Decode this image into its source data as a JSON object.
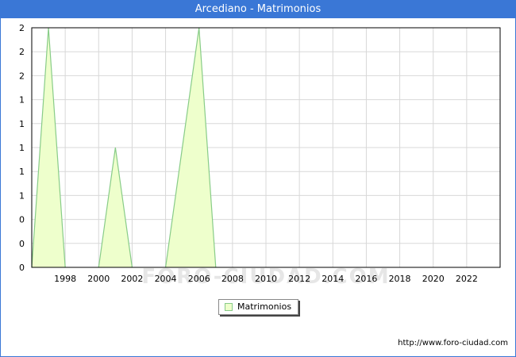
{
  "header": {
    "title": "Arcediano - Matrimonios"
  },
  "chart_data": {
    "type": "area",
    "title": "Arcediano - Matrimonios",
    "xlabel": "",
    "ylabel": "",
    "x": [
      1996,
      1997,
      1998,
      1999,
      2000,
      2001,
      2002,
      2003,
      2004,
      2005,
      2006,
      2007,
      2008,
      2009,
      2010,
      2011,
      2012,
      2013,
      2014,
      2015,
      2016,
      2017,
      2018,
      2019,
      2020,
      2021,
      2022
    ],
    "series": [
      {
        "name": "Matrimonios",
        "values": [
          0,
          2,
          0,
          0,
          0,
          1,
          0,
          0,
          0,
          1,
          2,
          0,
          0,
          0,
          0,
          0,
          0,
          0,
          0,
          0,
          0,
          0,
          0,
          0,
          0,
          0,
          0
        ]
      }
    ],
    "xlim": [
      1996,
      2024
    ],
    "ylim": [
      0,
      2
    ],
    "x_ticks": [
      1998,
      2000,
      2002,
      2004,
      2006,
      2008,
      2010,
      2012,
      2014,
      2016,
      2018,
      2020,
      2022
    ],
    "y_tick_labels": [
      "0",
      "0",
      "0",
      "1",
      "1",
      "1",
      "1",
      "1",
      "2",
      "2",
      "2"
    ],
    "grid": true,
    "legend_position": "bottom-center",
    "colors": {
      "fill": "#eeffcc",
      "line": "#88cc88",
      "header": "#3a77d6",
      "grid": "#d8d8d8"
    }
  },
  "legend": {
    "label": "Matrimonios"
  },
  "watermark": "FORO-CIUDAD.COM",
  "source": "http://www.foro-ciudad.com"
}
